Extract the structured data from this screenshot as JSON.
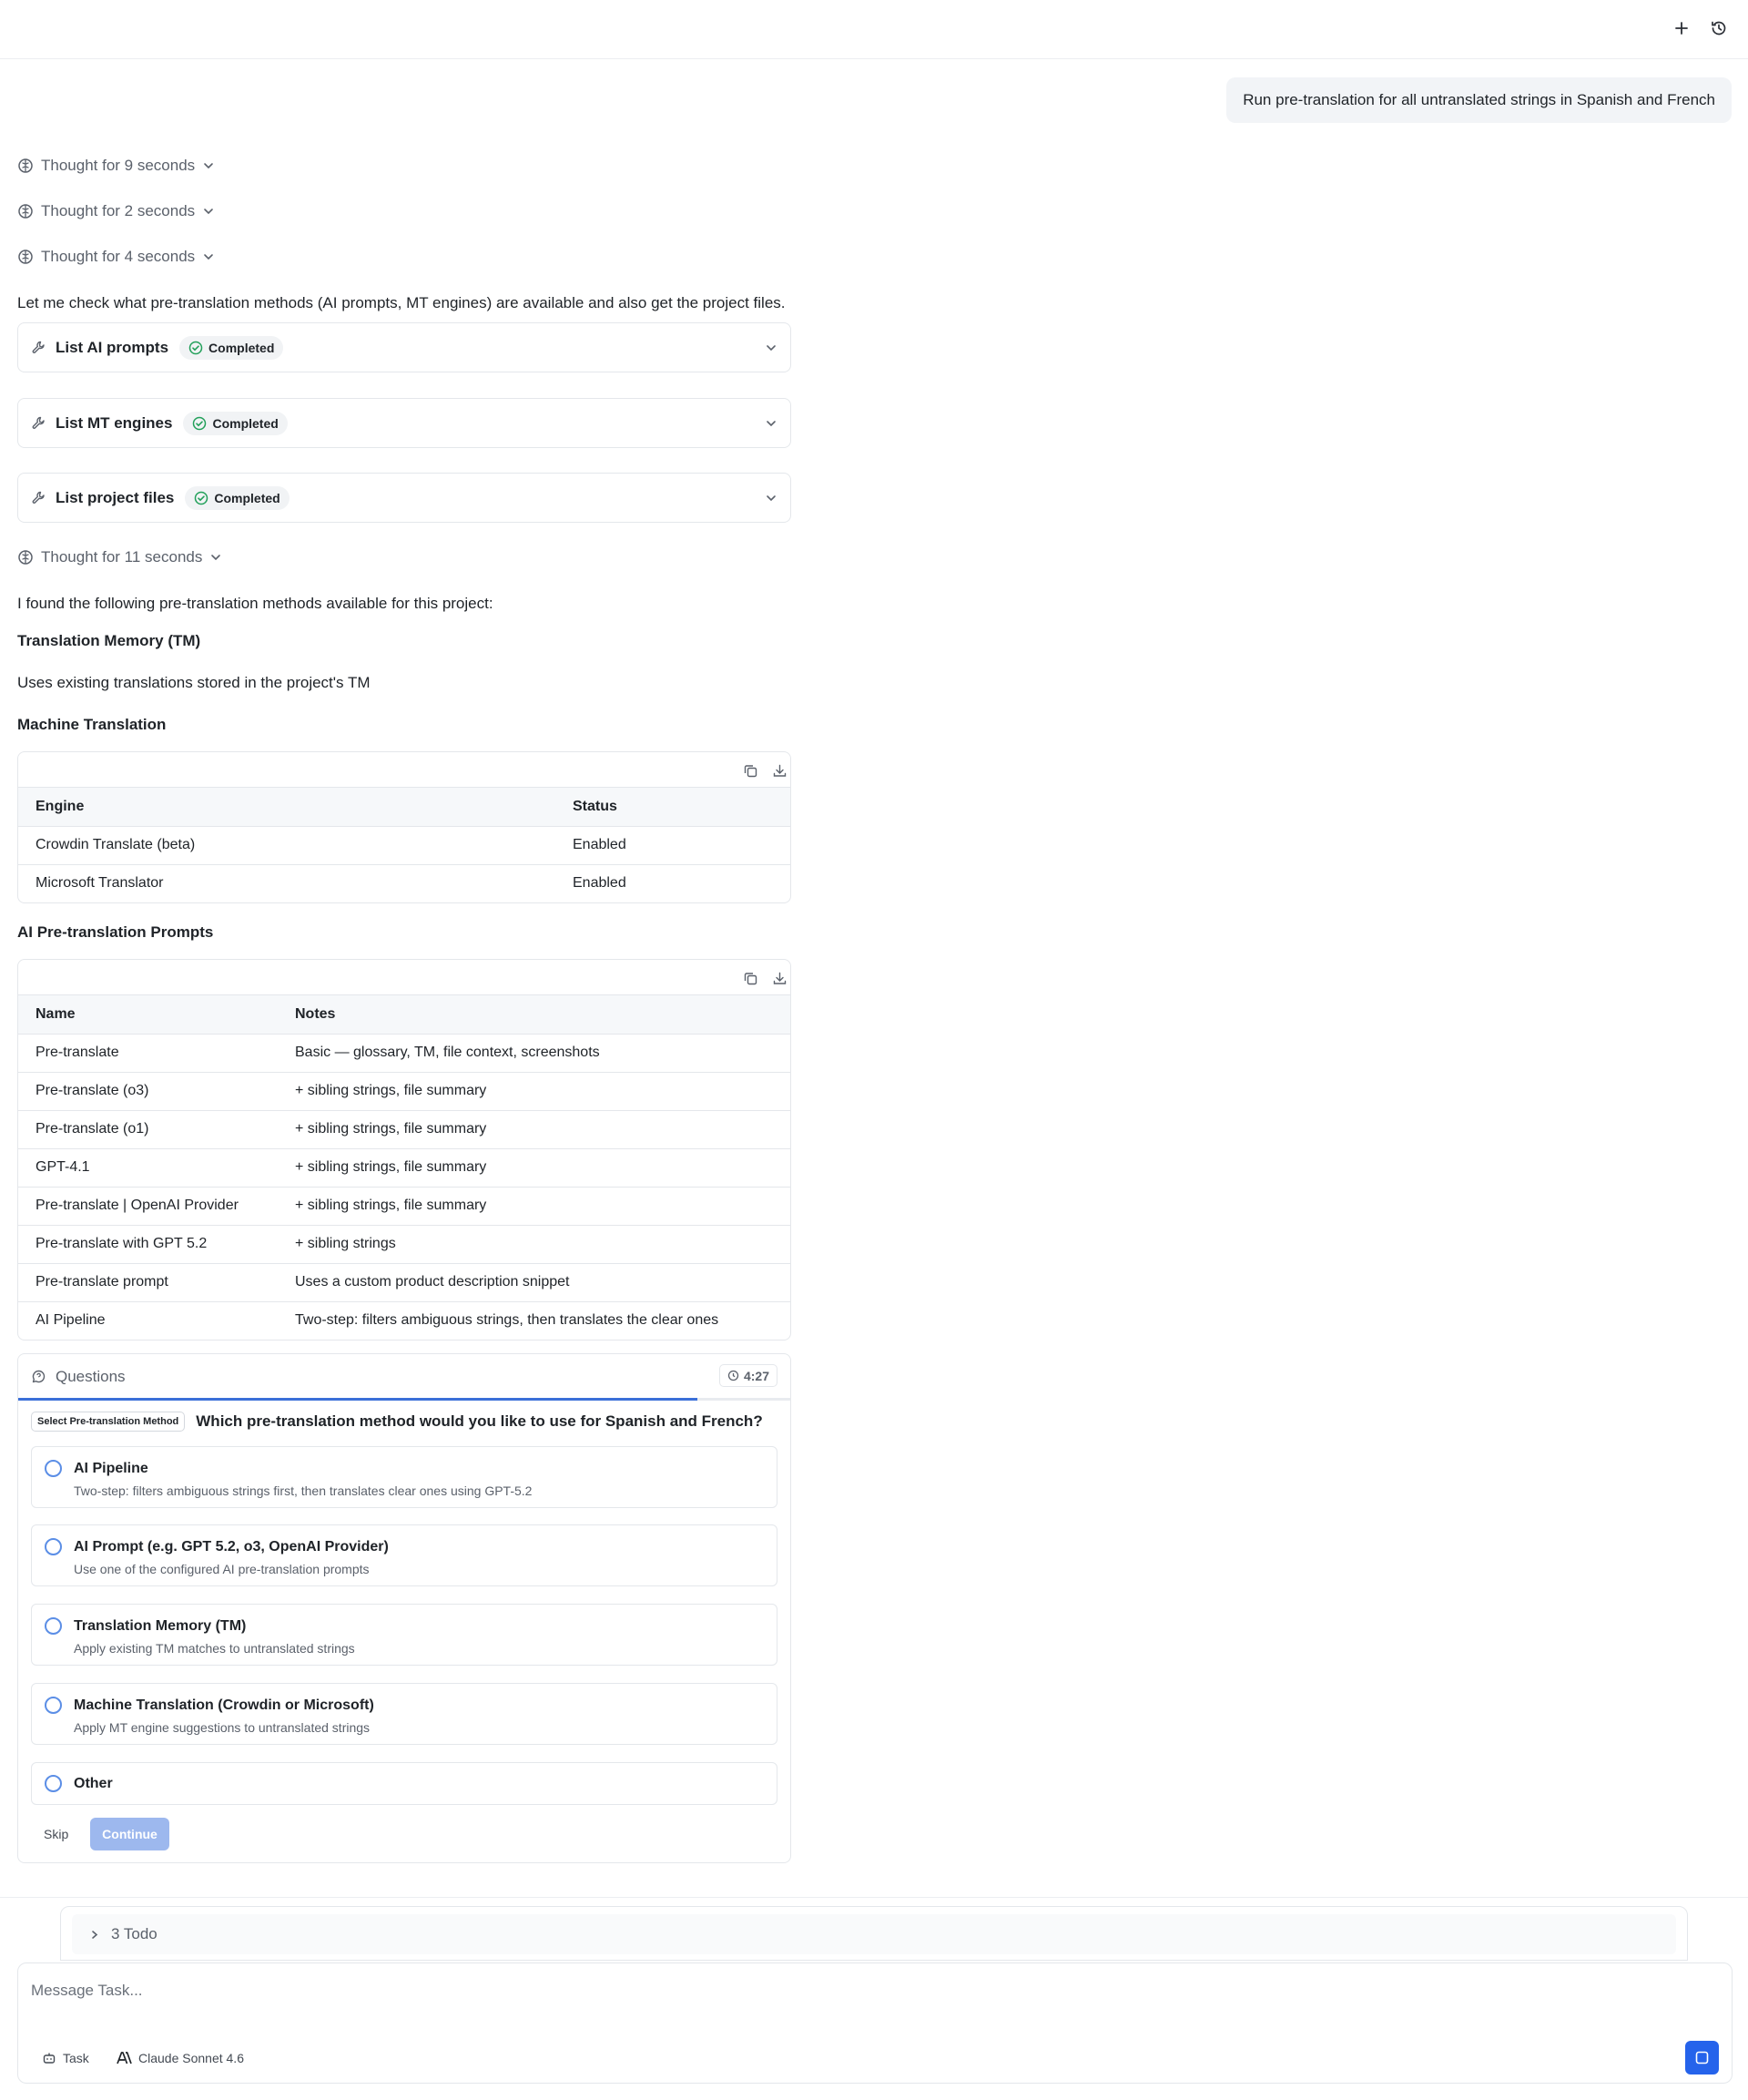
{
  "header": {
    "new_icon": "plus-icon",
    "history_icon": "history-icon"
  },
  "user_message": "Run pre-translation for all untranslated strings in Spanish and French",
  "thoughts": [
    "Thought for 9 seconds",
    "Thought for 2 seconds",
    "Thought for 4 seconds",
    "Thought for 11 seconds"
  ],
  "intro_text": "Let me check what pre-translation methods (AI prompts, MT engines) are available and also get the project files.",
  "tools": [
    {
      "name": "List AI prompts",
      "status": "Completed"
    },
    {
      "name": "List MT engines",
      "status": "Completed"
    },
    {
      "name": "List project files",
      "status": "Completed"
    }
  ],
  "found_text": "I found the following pre-translation methods available for this project:",
  "tm_heading": "Translation Memory (TM)",
  "tm_text": "Uses existing translations stored in the project's TM",
  "mt_heading": "Machine Translation",
  "mt_table": {
    "headers": [
      "Engine",
      "Status"
    ],
    "rows": [
      [
        "Crowdin Translate (beta)",
        "Enabled"
      ],
      [
        "Microsoft Translator",
        "Enabled"
      ]
    ]
  },
  "ai_heading": "AI Pre-translation Prompts",
  "ai_table": {
    "headers": [
      "Name",
      "Notes"
    ],
    "rows": [
      [
        "Pre-translate",
        "Basic — glossary, TM, file context, screenshots"
      ],
      [
        "Pre-translate (o3)",
        "+ sibling strings, file summary"
      ],
      [
        "Pre-translate (o1)",
        "+ sibling strings, file summary"
      ],
      [
        "GPT-4.1",
        "+ sibling strings, file summary"
      ],
      [
        "Pre-translate | OpenAI Provider",
        "+ sibling strings, file summary"
      ],
      [
        "Pre-translate with GPT 5.2",
        "+ sibling strings"
      ],
      [
        "Pre-translate prompt",
        "Uses a custom product description snippet"
      ],
      [
        "AI Pipeline",
        "Two-step: filters ambiguous strings, then translates the clear ones"
      ]
    ]
  },
  "questions": {
    "title": "Questions",
    "timer": "4:27",
    "progress": 0.88,
    "tag": "Select Pre-translation Method",
    "question": "Which pre-translation method would you like to use for Spanish and French?",
    "options": [
      {
        "label": "AI Pipeline",
        "desc": "Two-step: filters ambiguous strings first, then translates clear ones using GPT-5.2"
      },
      {
        "label": "AI Prompt (e.g. GPT 5.2, o3, OpenAI Provider)",
        "desc": "Use one of the configured AI pre-translation prompts"
      },
      {
        "label": "Translation Memory (TM)",
        "desc": "Apply existing TM matches to untranslated strings"
      },
      {
        "label": "Machine Translation (Crowdin or Microsoft)",
        "desc": "Apply MT engine suggestions to untranslated strings"
      },
      {
        "label": "Other",
        "desc": ""
      }
    ],
    "skip_label": "Skip",
    "continue_label": "Continue"
  },
  "todo": {
    "label": "3 Todo"
  },
  "composer": {
    "placeholder": "Message Task...",
    "mode_label": "Task",
    "model_label": "Claude Sonnet 4.6"
  }
}
